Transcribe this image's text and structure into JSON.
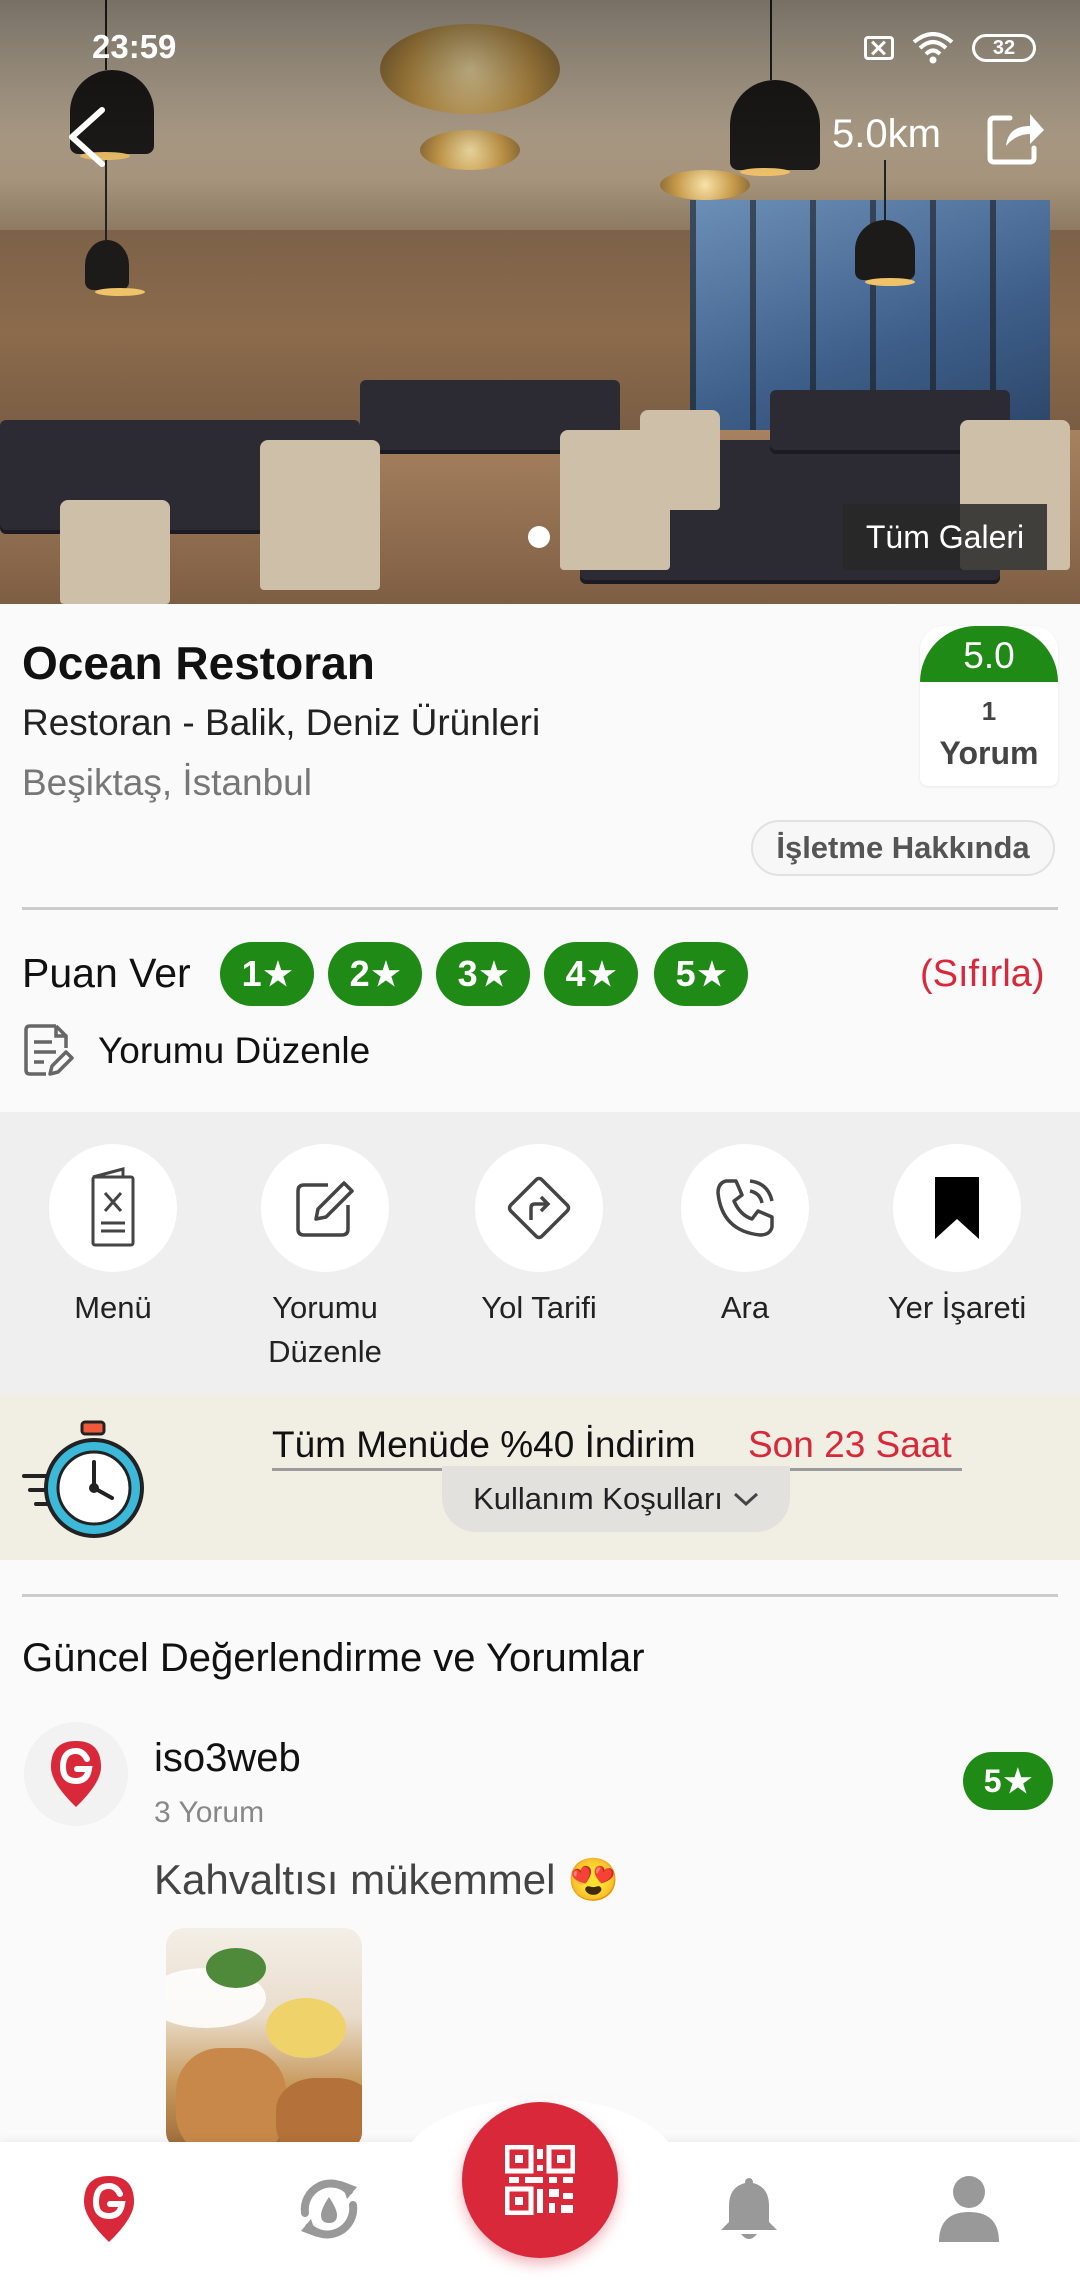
{
  "status_bar": {
    "time": "23:59",
    "battery": "32"
  },
  "header": {
    "distance": "5.0km",
    "gallery_label": "Tüm Galeri"
  },
  "place": {
    "name": "Ocean Restoran",
    "category": "Restoran - Balik, Deniz Ürünleri",
    "location": "Beşiktaş, İstanbul",
    "rating": "5.0",
    "review_count": "1",
    "review_word": "Yorum",
    "about_label": "İşletme Hakkında"
  },
  "rate": {
    "label": "Puan Ver",
    "options": [
      "1",
      "2",
      "3",
      "4",
      "5"
    ],
    "reset_label": "(Sıfırla)",
    "edit_label": "Yorumu Düzenle"
  },
  "actions": [
    {
      "label": "Menü",
      "icon": "menu-icon"
    },
    {
      "label": "Yorumu Düzenle",
      "icon": "edit-icon"
    },
    {
      "label": "Yol Tarifi",
      "icon": "directions-icon"
    },
    {
      "label": "Ara",
      "icon": "phone-icon"
    },
    {
      "label": "Yer İşareti",
      "icon": "bookmark-icon"
    }
  ],
  "promo": {
    "title": "Tüm Menüde %40 İndirim",
    "timer": "Son 23 Saat",
    "terms_label": "Kullanım Koşulları"
  },
  "reviews": {
    "title": "Güncel Değerlendirme ve Yorumlar",
    "items": [
      {
        "user": "iso3web",
        "count": "3 Yorum",
        "rating": "5",
        "text": "Kahvaltısı mükemmel 😍"
      }
    ]
  },
  "colors": {
    "brand_red": "#d8283a",
    "rating_green": "#1f8a16"
  }
}
